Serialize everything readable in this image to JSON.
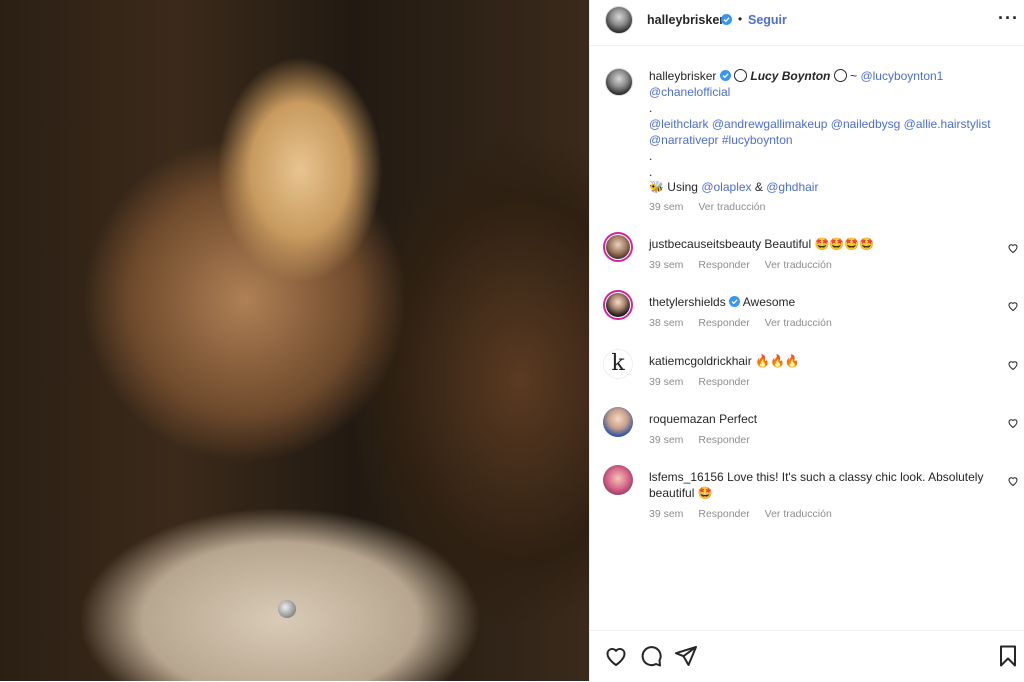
{
  "header": {
    "username": "halleybrisker",
    "dot": "•",
    "follow_label": "Seguir",
    "more_label": "···"
  },
  "caption": {
    "username": "halleybrisker",
    "line1_bold": "Lucy Boynton",
    "line1_sep": "~",
    "line1_mention": "@lucyboynton1",
    "line2": "@chanelofficial",
    "dot": ".",
    "line4": "@leithclark @andrewgallimakeup @nailedbysg @allie.hairstylist",
    "line5": "@narrativepr #lucyboynton",
    "using_prefix": "Using",
    "using_mention1": "@olaplex",
    "using_amp": "&",
    "using_mention2": "@ghdhair",
    "time": "39 sem",
    "translate": "Ver traducción"
  },
  "comments": [
    {
      "user": "justbecauseitsbeauty",
      "text": "Beautiful 🤩🤩🤩🤩",
      "time": "39 sem",
      "reply": "Responder",
      "translate": "Ver traducción"
    },
    {
      "user": "thetylershields",
      "text": "Awesome",
      "time": "38 sem",
      "reply": "Responder",
      "translate": "Ver traducción"
    },
    {
      "user": "katiemcgoldrickhair",
      "text": "🔥🔥🔥",
      "time": "39 sem",
      "reply": "Responder",
      "avatar_letter": "k"
    },
    {
      "user": "roquemazan",
      "text": "Perfect",
      "time": "39 sem",
      "reply": "Responder"
    },
    {
      "user": "lsfems_16156",
      "text": "Love this! It's such a classy chic look. Absolutely beautiful 🤩",
      "time": "39 sem",
      "reply": "Responder",
      "translate": "Ver traducción"
    }
  ],
  "icons": {
    "like": "heart-icon",
    "comment": "comment-icon",
    "share": "send-icon",
    "save": "bookmark-icon",
    "verified": "verified-badge-icon"
  },
  "colors": {
    "link": "#4c6ed8",
    "verified": "#3897f0",
    "ring": "#d6249f"
  }
}
